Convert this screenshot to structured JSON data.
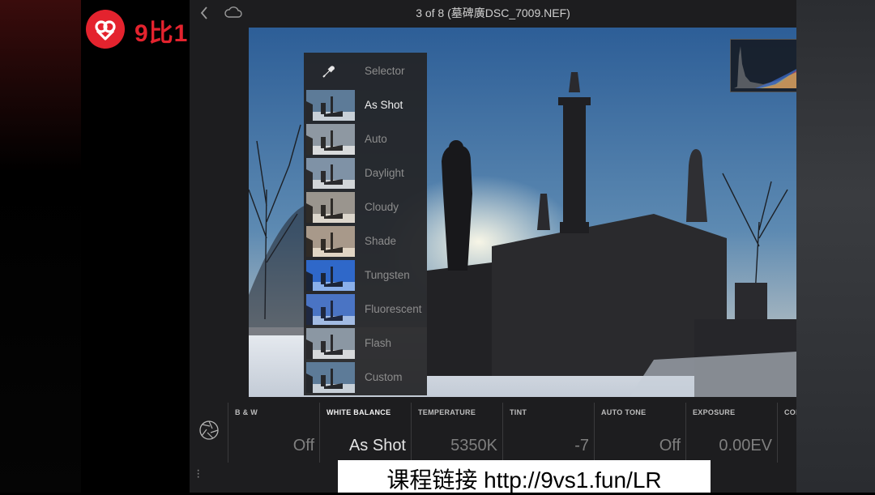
{
  "watermark": {
    "brand_text": "9比1"
  },
  "topbar": {
    "title": "3 of 8 (墓碑廣DSC_7009.NEF)"
  },
  "white_balance_menu": {
    "items": [
      {
        "label": "Selector",
        "selected": false
      },
      {
        "label": "As Shot",
        "selected": true
      },
      {
        "label": "Auto",
        "selected": false
      },
      {
        "label": "Daylight",
        "selected": false
      },
      {
        "label": "Cloudy",
        "selected": false
      },
      {
        "label": "Shade",
        "selected": false
      },
      {
        "label": "Tungsten",
        "selected": false
      },
      {
        "label": "Fluorescent",
        "selected": false
      },
      {
        "label": "Flash",
        "selected": false
      },
      {
        "label": "Custom",
        "selected": false
      }
    ]
  },
  "controls": [
    {
      "label": "B & W",
      "value": "Off"
    },
    {
      "label": "WHITE BALANCE",
      "value": "As Shot",
      "active": true
    },
    {
      "label": "TEMPERATURE",
      "value": "5350K"
    },
    {
      "label": "TINT",
      "value": "-7"
    },
    {
      "label": "AUTO TONE",
      "value": "Off"
    },
    {
      "label": "EXPOSURE",
      "value": "0.00EV"
    },
    {
      "label": "CON",
      "value": ""
    }
  ],
  "subtitle": {
    "text": "课程链接 http://9vs1.fun/LR"
  },
  "colors": {
    "accent_red": "#e4232e",
    "app_bg": "#1d1d1f"
  }
}
